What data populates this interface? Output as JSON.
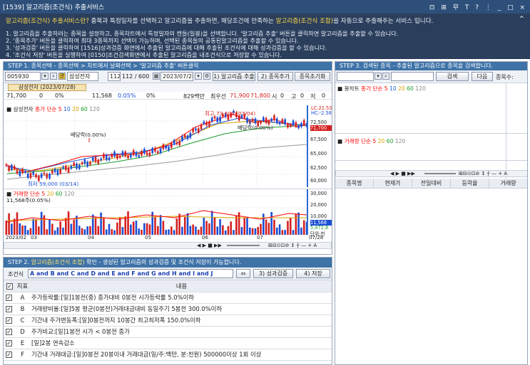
{
  "window": {
    "title": "[1539] 알고리즘(조건식) 추출서비스",
    "controls": "⊡ ⊞ 무 T ? ⋮ _ □ ×"
  },
  "info": {
    "heading_q": "알고리즘(조건식) 추출서비스란?",
    "heading_text": " 종목과 특정일자를 선택하고 알고리즘을 추출하면, 해당조건에 만족하는 ",
    "heading_hl": "알고리즘(조건식 조합)",
    "heading_tail": "을 자동으로 추출해주는 서비스 입니다.",
    "lines": [
      "1. 알고리즘을 추출하려는 종목을 설정하고, 종목차트에서 특정일자의 캔들(일봉)을 선택합니다. '알고리즘 추출' 버튼을 클릭하면 알고리즘을 추출할 수 있습니다.",
      "2. '종목추가' 버튼을 클릭하여 최대 3종목까지 선택이 가능하며, 선택된 종목들의 공통된알고리즘을 추출할 수 있습니다.",
      "3. '성과검증' 버튼을 클릭하여 [1516]성과검증 화면에서 추출된 알고리즘에 대해 추출된 조건식에 대해 성과검증을 할 수 있습니다.",
      "4. '조건식 저장' 버튼을 실행하여 [0150]조건검색화면에서 추출된 알고리즘을 내조건식으로 저장할 수 있습니다."
    ],
    "collapse": "^"
  },
  "step1": {
    "title": "STEP 1. 종목선택 - 종목선택 > 차트에서 날짜선택 > '알고리즘 추출' 버튼클릭",
    "code": "005930",
    "name": "삼성전자",
    "count": "112 / 600",
    "date": "2023/07/28",
    "btn_extract": "1) 알고리즘 추출",
    "btn_add": "2) 종목추가",
    "btn_reset": "종목초기화",
    "selected_tag": "삼성전자 (2023/07/28)",
    "ohlc": [
      "71,700",
      "0",
      "0%",
      "11,568",
      "0.05%",
      "0%",
      "829백만",
      "최우선",
      "71,900",
      "71,800",
      "시",
      "0",
      "고",
      "0",
      "저",
      "0"
    ],
    "legend_name": "삼성전자",
    "legend_type": "종가 단순",
    "legend_ma": [
      "5",
      "10",
      "20",
      "60",
      "120"
    ],
    "ann_high": "최고 73,600 (07/04)",
    "ann_low": "최저 59,000 (03/14)",
    "ann_vb1": "배당락(0.00%)",
    "ann_vb2": "배당락(0.00%)",
    "right_labels": [
      "LC:21.53",
      "HC:-2.58"
    ],
    "y_ticks": [
      "72,500",
      "70,000",
      "67,500",
      "65,000",
      "62,500",
      "60,000"
    ],
    "price_tag": "71,700",
    "vol_legend": "거래량 단순",
    "vol_ma": [
      "5",
      "20",
      "60",
      "120"
    ],
    "vol_value": "11,568주(0.05%)",
    "vol_ticks": [
      "30,000",
      "20,000",
      "10,000"
    ],
    "vol_tags": [
      "11,568",
      "5,472,8"
    ],
    "vol_unit": "단위:천",
    "x_ticks": [
      "2023/02",
      "03",
      "04",
      "05",
      "06",
      "07",
      "07/28"
    ]
  },
  "step2": {
    "title_pre": "STEP 2. ",
    "title_hl": "알고리즘(조건식 조합)",
    "title_post": " 확인 - 생성된 알고리즘의 성과검증 및 조건식 저장이 가능합니다.",
    "cond_label": "조건식",
    "cond_expr": "A and B and C and D and E and F and G and H and I and J",
    "btn_swap": "⇔",
    "btn_verify": "3) 성과검증",
    "btn_save": "4) 저장",
    "col_index": "지표",
    "col_content": "내용",
    "rows": [
      {
        "id": "A",
        "text": "주가등락률:[일]1봉전(중) 종가대비 0봉전 시가등락률 5.0%이하"
      },
      {
        "id": "B",
        "text": "거래량비율:[일]5봉 평균(0봉전)거래대금대비 동일주기 5봉전 300.0%이하"
      },
      {
        "id": "C",
        "text": "기간내 주가변동폭:[일]0봉전까지 10봉간 최고최저폭 150.0%이하"
      },
      {
        "id": "D",
        "text": "주가비교:[일]1봉전 시가 < 0봉전 종가"
      },
      {
        "id": "E",
        "text": "[일]2봉 연속감소"
      },
      {
        "id": "F",
        "text": "기간내 거래대금:[일]0봉전 20봉이내 거래대금(일/주:백만, 분:천원) 500000이상 1회 이상"
      }
    ]
  },
  "step3": {
    "title": "STEP 3. 검색된 종목 - 추출된 알고리즘으로 종목을 검색합니다.",
    "btn_search": "검색",
    "btn_next": "다음",
    "count_label": "종목수:",
    "legend_type": "봉차트",
    "legend_sub": "종가 단순",
    "legend_ma": [
      "5",
      "10",
      "20",
      "60",
      "120"
    ],
    "vol_legend": "거래량 단순",
    "vol_ma": [
      "5",
      "20",
      "60",
      "120"
    ],
    "cols": [
      "종목명",
      "현재가",
      "전일대비",
      "등락율",
      "거래량"
    ]
  }
}
